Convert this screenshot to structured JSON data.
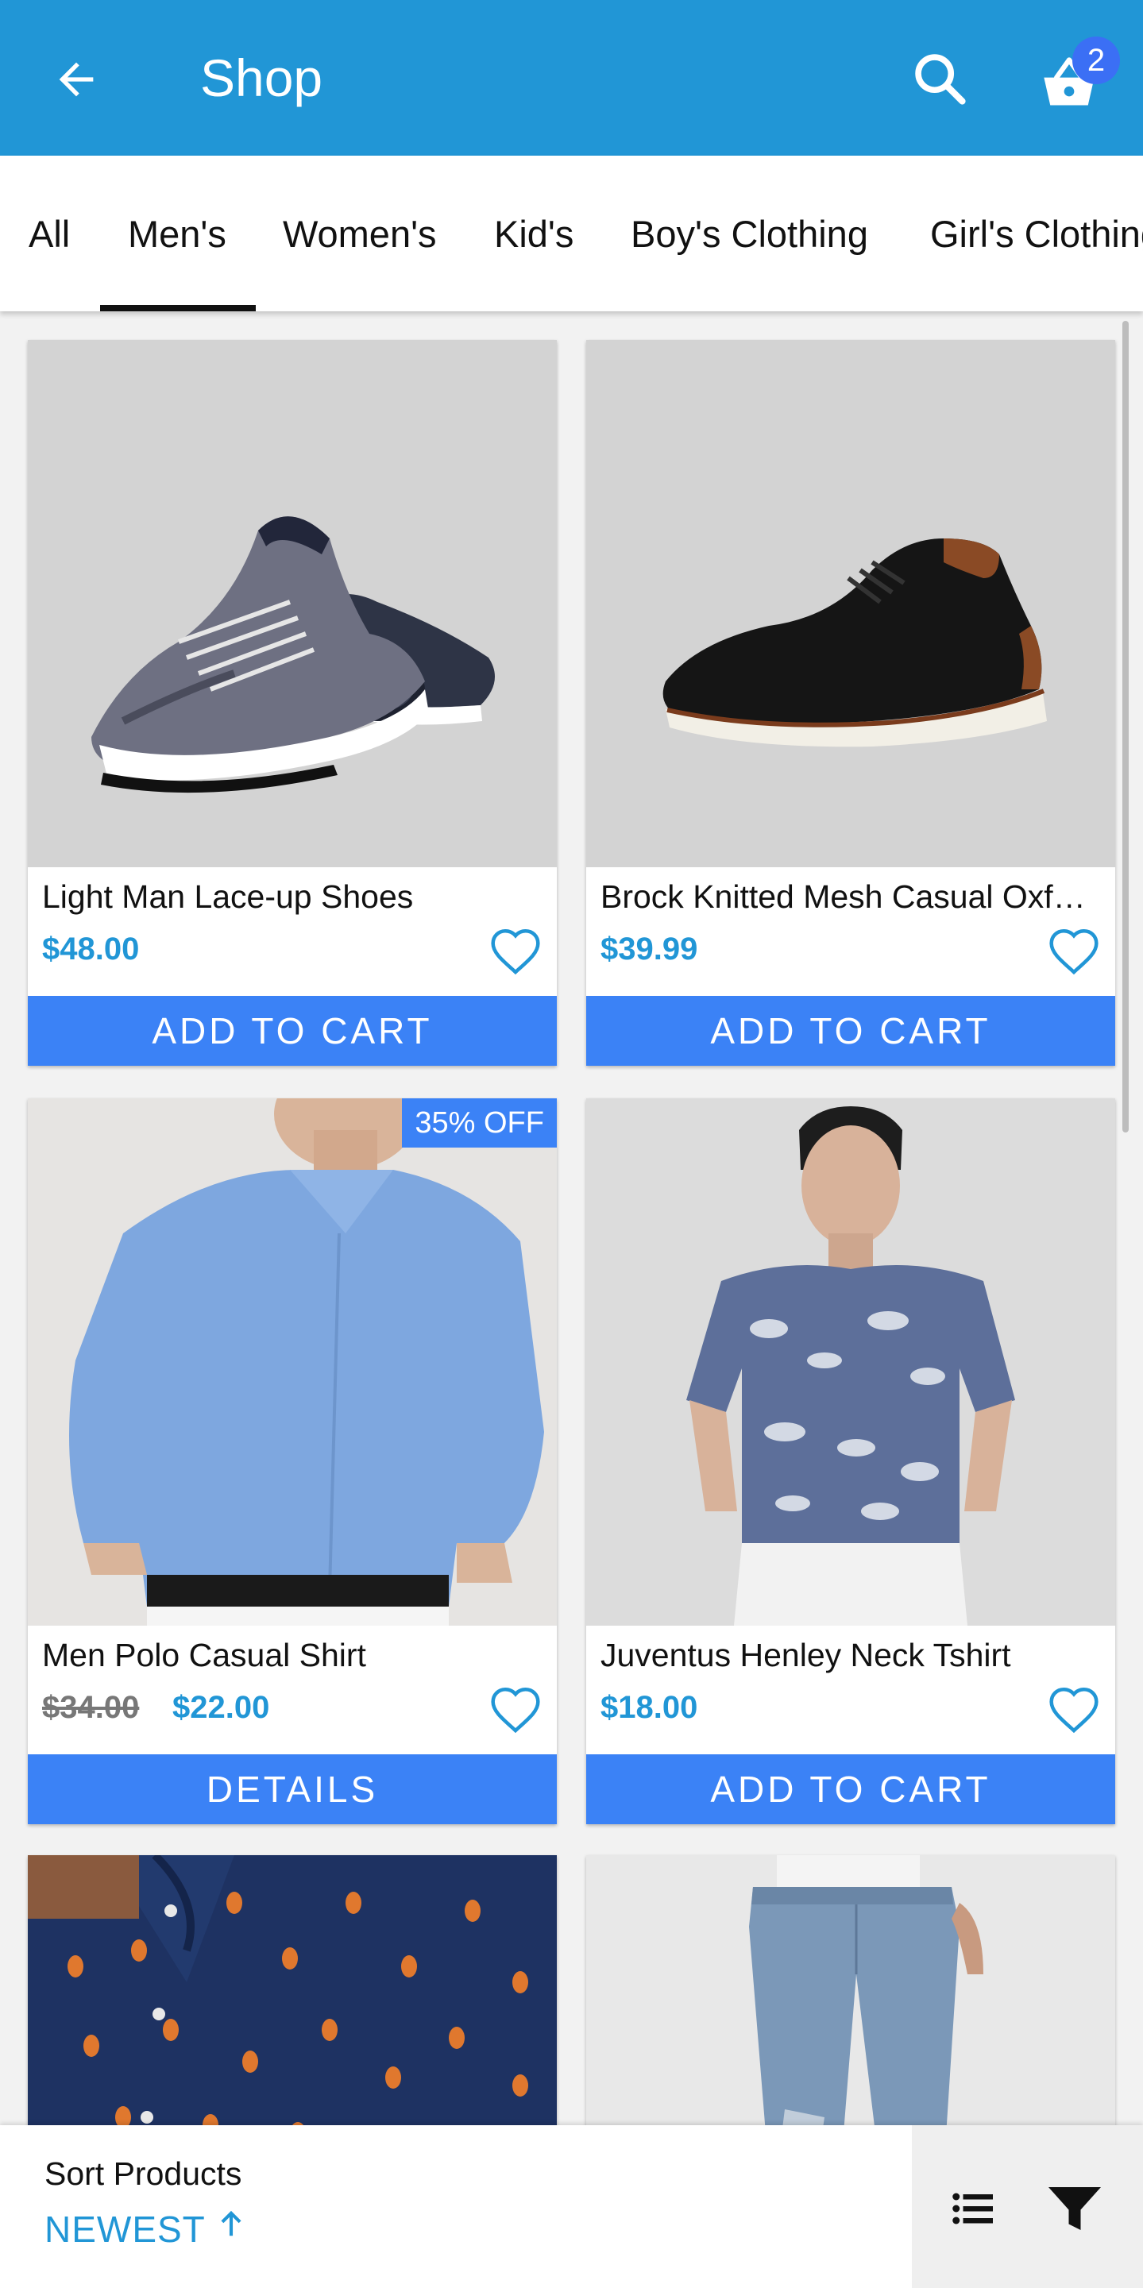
{
  "appbar": {
    "title": "Shop",
    "cart_count": "2",
    "back_icon": "arrow-left-icon",
    "search_icon": "search-icon",
    "cart_icon": "shopping-basket-icon",
    "color": "#2196d6"
  },
  "tabs": {
    "items": [
      "All",
      "Men's",
      "Women's",
      "Kid's",
      "Boy's Clothing",
      "Girl's Clothing"
    ],
    "selected": "Men's"
  },
  "products": [
    {
      "name": "Light Man Lace-up Shoes",
      "price": "$48.00",
      "button": "ADD TO CART",
      "image": "grey knit sneaker pair"
    },
    {
      "name": "Brock Knitted Mesh Casual Oxford",
      "price": "$39.99",
      "button": "ADD TO CART",
      "image": "black knit oxford shoe"
    },
    {
      "name": "Men Polo Casual Shirt",
      "old_price": "$34.00",
      "price": "$22.00",
      "button": "DETAILS",
      "badge": "35% OFF",
      "image": "man in light blue shirt"
    },
    {
      "name": "Juventus Henley Neck Tshirt",
      "price": "$18.00",
      "button": "ADD TO CART",
      "image": "man in floral print tshirt"
    },
    {
      "name": "",
      "image": "navy shirt with orange print"
    },
    {
      "name": "",
      "image": "blue skinny jeans"
    }
  ],
  "bottombar": {
    "sort_label": "Sort Products",
    "sort_value": "NEWEST",
    "sort_icon": "arrow-up-icon",
    "list_icon": "list-view-icon",
    "filter_icon": "filter-icon"
  },
  "colors": {
    "accent": "#2196d6",
    "button": "#3b82f6"
  }
}
